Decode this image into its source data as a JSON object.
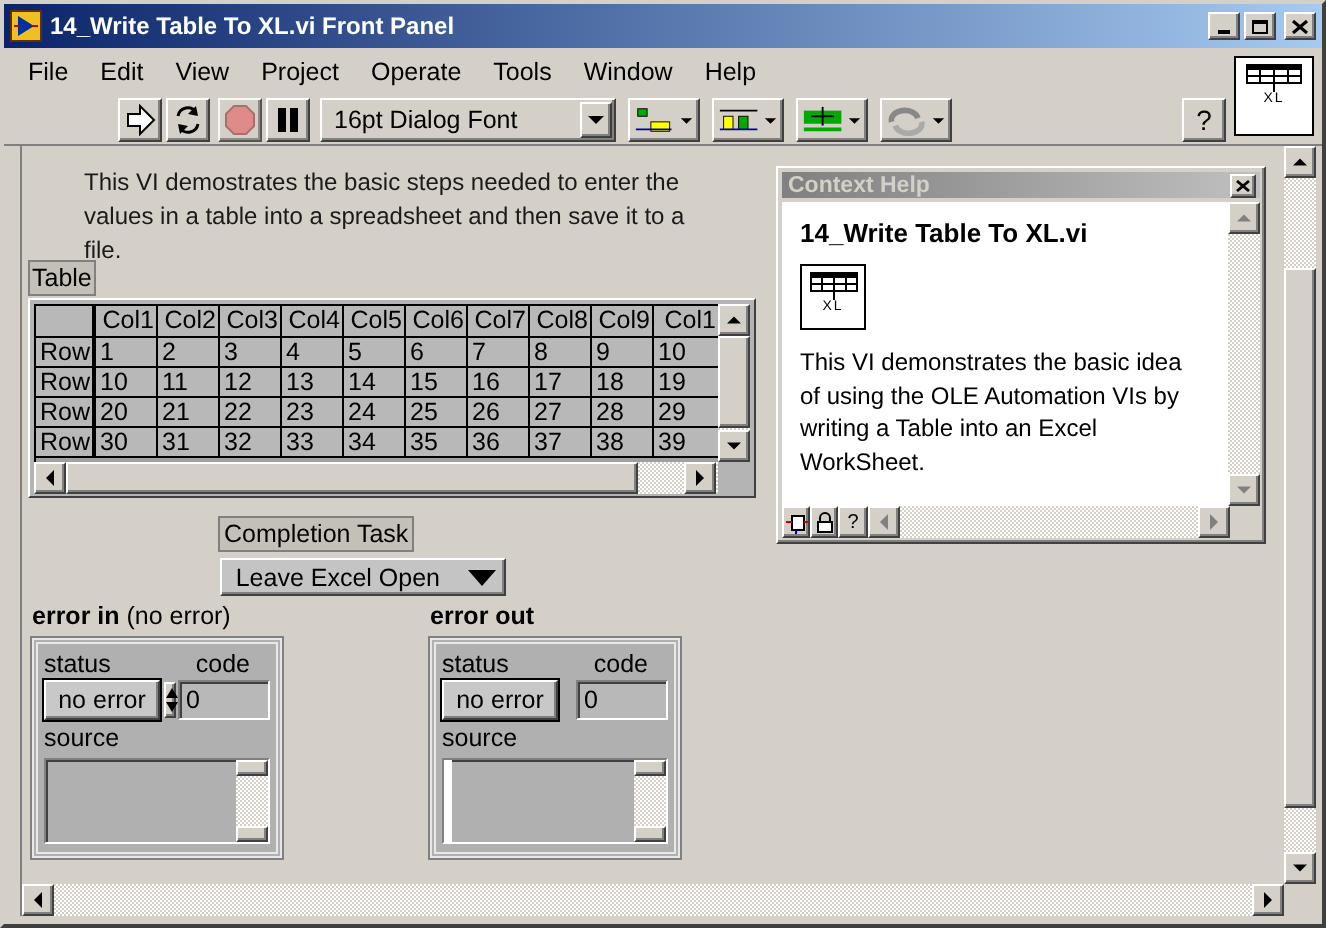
{
  "window": {
    "title": "14_Write Table To XL.vi Front Panel",
    "icon_label": "XL"
  },
  "menu": [
    {
      "label": "File"
    },
    {
      "label": "Edit"
    },
    {
      "label": "View"
    },
    {
      "label": "Project"
    },
    {
      "label": "Operate"
    },
    {
      "label": "Tools"
    },
    {
      "label": "Window"
    },
    {
      "label": "Help"
    }
  ],
  "toolbar": {
    "font": "16pt Dialog Font",
    "help": "?"
  },
  "description": "This VI demostrates the basic steps needed to enter the values in a table into a spreadsheet and then save it to a file.",
  "table": {
    "label": "Table",
    "columns": [
      "Col1",
      "Col2",
      "Col3",
      "Col4",
      "Col5",
      "Col6",
      "Col7",
      "Col8",
      "Col9",
      "Col1"
    ],
    "rows": [
      {
        "header": "Row",
        "cells": [
          "1",
          "2",
          "3",
          "4",
          "5",
          "6",
          "7",
          "8",
          "9",
          "10"
        ]
      },
      {
        "header": "Row",
        "cells": [
          "10",
          "11",
          "12",
          "13",
          "14",
          "15",
          "16",
          "17",
          "18",
          "19"
        ]
      },
      {
        "header": "Row",
        "cells": [
          "20",
          "21",
          "22",
          "23",
          "24",
          "25",
          "26",
          "27",
          "28",
          "29"
        ]
      },
      {
        "header": "Row",
        "cells": [
          "30",
          "31",
          "32",
          "33",
          "34",
          "35",
          "36",
          "37",
          "38",
          "39"
        ]
      }
    ]
  },
  "context_help": {
    "title": "Context Help",
    "vi_name": "14_Write Table To XL.vi",
    "icon_label": "XL",
    "description": "This VI demonstrates the basic idea of using the OLE Automation VIs by writing a Table into an Excel WorkSheet.",
    "help_button": "?"
  },
  "completion_task": {
    "label": "Completion Task",
    "value": "Leave Excel Open"
  },
  "error_in": {
    "kind": "control",
    "label": "error in",
    "note": "(no error)",
    "status_label": "status",
    "status": "no error",
    "code_label": "code",
    "code": "0",
    "source_label": "source"
  },
  "error_out": {
    "kind": "indicator",
    "label": "error out",
    "status_label": "status",
    "status": "no error",
    "code_label": "code",
    "code": "0",
    "source_label": "source"
  }
}
